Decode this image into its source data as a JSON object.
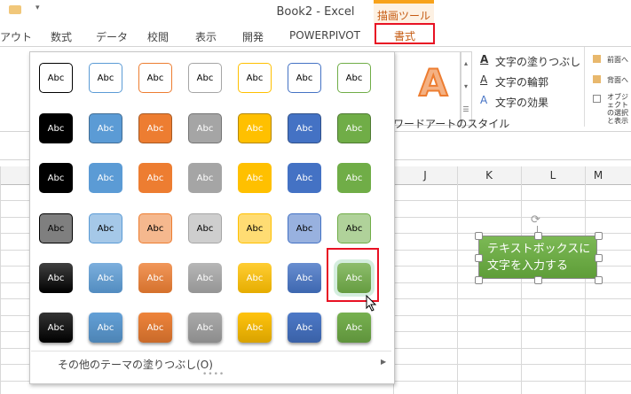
{
  "window": {
    "title": "Book2 - Excel",
    "tool_context": "描画ツール"
  },
  "tabs": [
    "アウト",
    "数式",
    "データ",
    "校閲",
    "表示",
    "開発",
    "POWERPIVOT"
  ],
  "active_tab": "書式",
  "ribbon": {
    "text_fill": "文字の塗りつぶし",
    "text_outline": "文字の輪郭",
    "text_effects": "文字の効果",
    "group_label": "ワードアートのスタイル",
    "wordart_sample": "A",
    "bring_forward": "前面へ",
    "send_backward": "背面へ",
    "selection_pane": "オブジェクトの選択と表示"
  },
  "columns": [
    "J",
    "K",
    "L",
    "M"
  ],
  "gallery": {
    "sample_text": "Abc",
    "colors": [
      "#000000",
      "#5B9BD5",
      "#ED7D31",
      "#A5A5A5",
      "#FFC000",
      "#4472C4",
      "#70AD47"
    ],
    "row_styles": [
      "outline",
      "solid",
      "solid-flat",
      "light",
      "gradient",
      "intense"
    ],
    "selected": {
      "row": 4,
      "col": 6
    },
    "more_label": "その他のテーマの塗りつぶし(O)"
  },
  "textbox": {
    "line1": "テキストボックスに",
    "line2": "文字を入力する"
  }
}
